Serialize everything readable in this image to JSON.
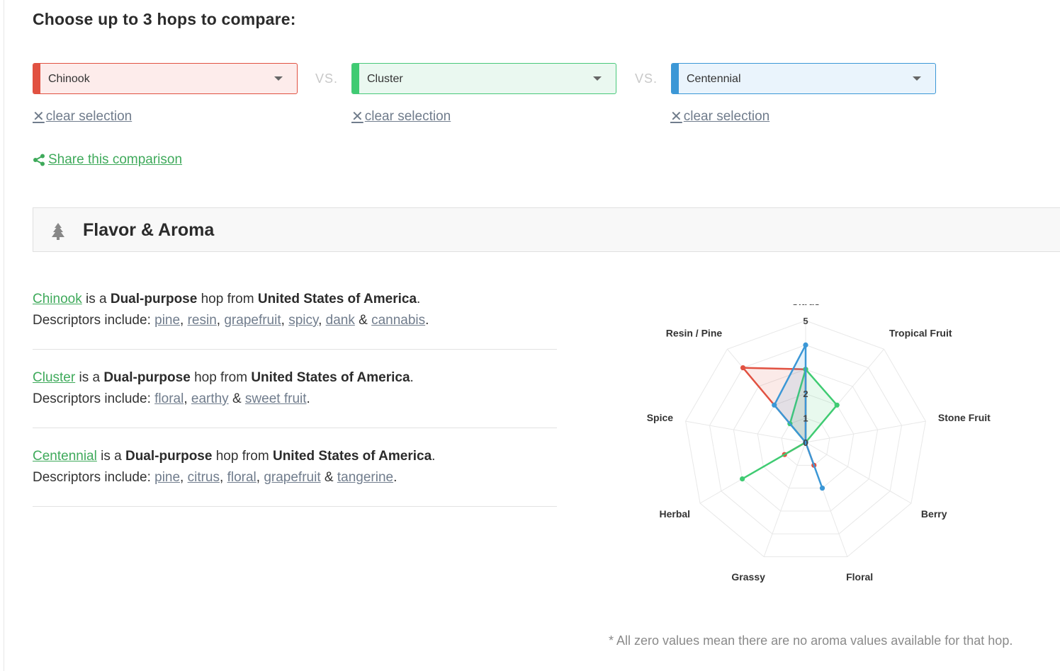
{
  "page": {
    "title": "Choose up to 3 hops to compare:"
  },
  "selectors": [
    {
      "value": "Chinook",
      "color": "#e15141"
    },
    {
      "value": "Cluster",
      "color": "#3fcb72"
    },
    {
      "value": "Centennial",
      "color": "#3b97d6"
    }
  ],
  "vs_label": "VS.",
  "clear_label": "clear selection",
  "share_label": "Share this comparison",
  "section": {
    "title": "Flavor & Aroma"
  },
  "hops": [
    {
      "name": "Chinook",
      "is_a": "is a",
      "purpose": "Dual-purpose",
      "hop_from": "hop from",
      "origin": "United States of America",
      "descriptors_label": "Descriptors include:",
      "descriptors": [
        "pine",
        "resin",
        "grapefruit",
        "spicy",
        "dank",
        "cannabis"
      ]
    },
    {
      "name": "Cluster",
      "is_a": "is a",
      "purpose": "Dual-purpose",
      "hop_from": "hop from",
      "origin": "United States of America",
      "descriptors_label": "Descriptors include:",
      "descriptors": [
        "floral",
        "earthy",
        "sweet fruit"
      ]
    },
    {
      "name": "Centennial",
      "is_a": "is a",
      "purpose": "Dual-purpose",
      "hop_from": "hop from",
      "origin": "United States of America",
      "descriptors_label": "Descriptors include:",
      "descriptors": [
        "pine",
        "citrus",
        "floral",
        "grapefruit",
        "tangerine"
      ]
    }
  ],
  "footnote": "* All zero values mean there are no aroma values available for that hop.",
  "chart_data": {
    "type": "radar",
    "categories": [
      "Citrus",
      "Tropical Fruit",
      "Stone Fruit",
      "Berry",
      "Floral",
      "Grassy",
      "Herbal",
      "Spice",
      "Resin / Pine"
    ],
    "ticks": [
      0,
      1,
      2,
      3,
      4,
      5
    ],
    "tick_labels": [
      "0",
      "1",
      "2",
      "",
      "",
      "5"
    ],
    "rlim": [
      0,
      5
    ],
    "series": [
      {
        "values": [
          3.0,
          0.0,
          0.0,
          0.0,
          1.0,
          0.0,
          1.0,
          0.0,
          4.0
        ],
        "color": "#e15141"
      },
      {
        "values": [
          3.0,
          2.0,
          0.0,
          0.0,
          0.0,
          0.0,
          3.0,
          0.0,
          1.0
        ],
        "color": "#3fcb72"
      },
      {
        "values": [
          4.0,
          0.0,
          0.0,
          0.0,
          2.0,
          0.0,
          0.0,
          0.0,
          2.0
        ],
        "color": "#3b97d6"
      }
    ]
  }
}
